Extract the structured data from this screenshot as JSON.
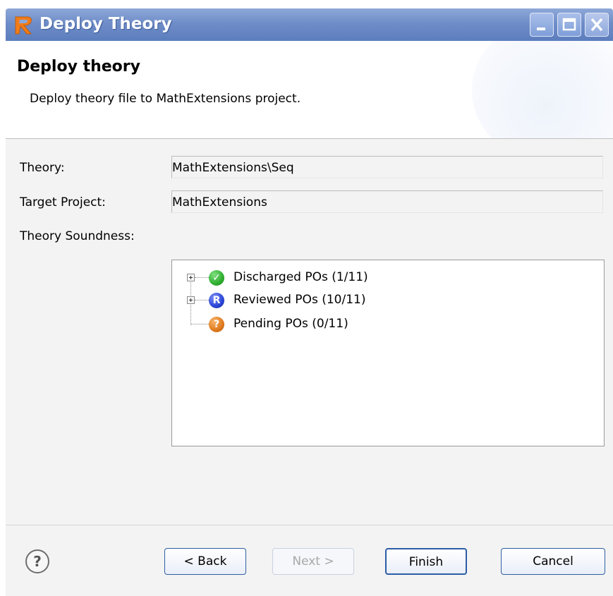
{
  "window": {
    "title": "Deploy Theory",
    "controls": [
      "minimize-icon",
      "maximize-icon",
      "close-icon"
    ]
  },
  "header": {
    "title": "Deploy theory",
    "description": "Deploy theory file to MathExtensions project."
  },
  "form": {
    "theory_label": "Theory:",
    "theory_value": "MathExtensions\\Seq",
    "target_label": "Target Project:",
    "target_value": "MathExtensions",
    "soundness_label": "Theory Soundness:"
  },
  "soundness_tree": [
    {
      "label": "Discharged POs (1/11)",
      "icon": "check-icon",
      "expandable": true,
      "color": "#2fae2f"
    },
    {
      "label": "Reviewed POs (10/11)",
      "icon": "r-icon",
      "expandable": true,
      "color": "#2b45d6"
    },
    {
      "label": "Pending POs (0/11)",
      "icon": "question-icon",
      "expandable": false,
      "color": "#e07a1e"
    }
  ],
  "buttons": {
    "back": "< Back",
    "next": "Next >",
    "finish": "Finish",
    "cancel": "Cancel"
  },
  "icons": {
    "app": "rodin-logo-icon",
    "help": "help-icon",
    "check_glyph": "✓",
    "r_glyph": "R",
    "question_glyph": "?",
    "help_glyph": "?"
  }
}
